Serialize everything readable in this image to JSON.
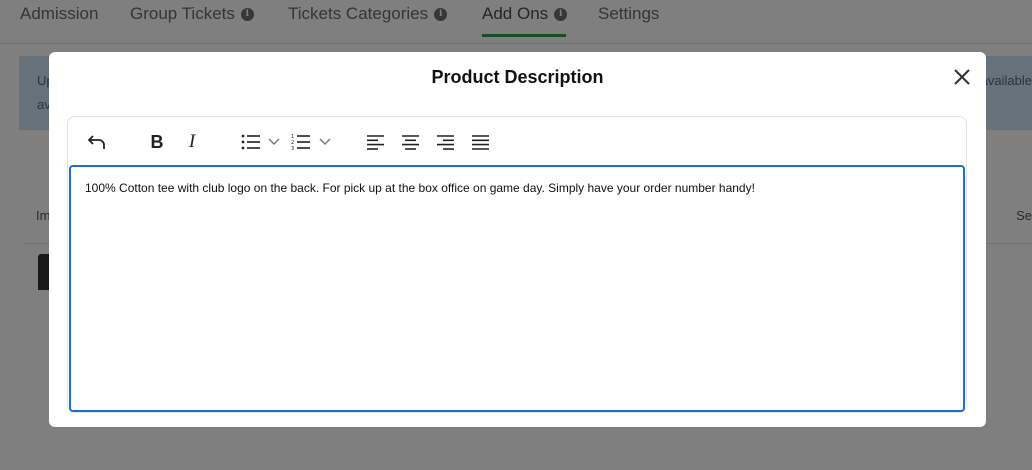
{
  "tabs": [
    {
      "label": "Admission",
      "info": false
    },
    {
      "label": "Group Tickets",
      "info": true
    },
    {
      "label": "Tickets Categories",
      "info": true
    },
    {
      "label": "Add Ons",
      "info": true,
      "active": true
    },
    {
      "label": "Settings",
      "info": false
    }
  ],
  "banner": {
    "line1": "Up",
    "line2": "av",
    "right": "available"
  },
  "table": {
    "col_left": "Im",
    "col_right": "Se"
  },
  "modal": {
    "title": "Product Description",
    "content": "100% Cotton tee with club logo on the back. For pick up at the box office on game day. Simply have your order number handy!"
  },
  "colors": {
    "accent": "#1e6fd0",
    "tab_underline": "#2e9b4e",
    "banner": "#cfe3f5"
  },
  "icons": [
    "undo-icon",
    "bold-icon",
    "italic-icon",
    "bulleted-list-icon",
    "numbered-list-icon",
    "chevron-down-icon",
    "align-left-icon",
    "align-center-icon",
    "align-right-icon",
    "align-justify-icon",
    "close-icon",
    "info-icon"
  ]
}
